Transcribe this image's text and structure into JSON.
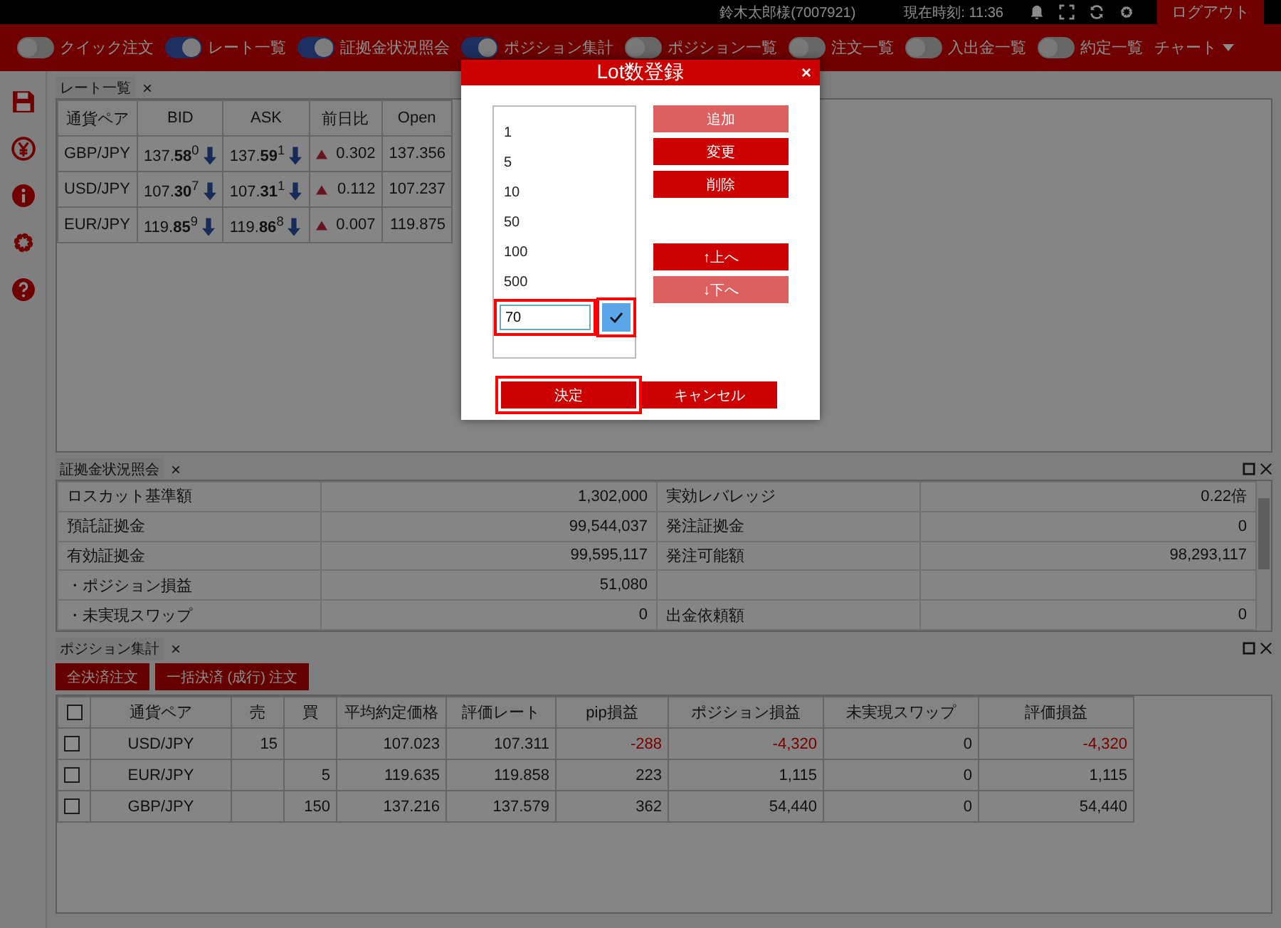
{
  "header": {
    "user": "鈴木太郎様(7007921)",
    "clock": "現在時刻: 11:36",
    "logout": "ログアウト"
  },
  "toolbar": {
    "toggles": [
      {
        "label": "クイック注文",
        "on": false
      },
      {
        "label": "レート一覧",
        "on": true
      },
      {
        "label": "証拠金状況照会",
        "on": true
      },
      {
        "label": "ポジション集計",
        "on": true
      },
      {
        "label": "ポジション一覧",
        "on": false
      },
      {
        "label": "注文一覧",
        "on": false
      },
      {
        "label": "入出金一覧",
        "on": false
      },
      {
        "label": "約定一覧",
        "on": false
      }
    ],
    "chart_menu": "チャート"
  },
  "rate_panel": {
    "tab": "レート一覧",
    "close": "×",
    "columns": [
      "通貨ペア",
      "BID",
      "ASK",
      "前日比",
      "Open"
    ],
    "rows": [
      {
        "pair": "GBP/JPY",
        "bid": "137.**58**$^{0}$",
        "ask": "137.**59**$^{1}$",
        "change": "0.302",
        "open": "137.356"
      },
      {
        "pair": "USD/JPY",
        "bid": "107.**30**$^{7}$",
        "ask": "107.**31**$^{1}$",
        "change": "0.112",
        "open": "107.237"
      },
      {
        "pair": "EUR/JPY",
        "bid": "119.**85**$^{9}$",
        "ask": "119.**86**$^{8}$",
        "change": "0.007",
        "open": "119.875"
      }
    ]
  },
  "margin_panel": {
    "tab": "証拠金状況照会",
    "close": "×",
    "rows": [
      {
        "label1": "ロスカット基準額",
        "value1": "1,302,000",
        "label2": "実効レバレッジ",
        "value2": "0.22倍"
      },
      {
        "label1": "預託証拠金",
        "value1": "99,544,037",
        "label2": "発注証拠金",
        "value2": "0"
      },
      {
        "label1": "有効証拠金",
        "value1": "99,595,117",
        "label2": "発注可能額",
        "value2": "98,293,117"
      },
      {
        "label1": "・ポジション損益",
        "value1": "51,080"
      },
      {
        "label1": "・未実現スワップ",
        "value1": "0",
        "label2": "出金依頼額",
        "value2": "0"
      }
    ]
  },
  "position_panel": {
    "tab": "ポジション集計",
    "close": "×",
    "buttons": [
      "全決済注文",
      "一括決済 (成行) 注文"
    ],
    "select_all_checked": false,
    "columns": [
      "通貨ペア",
      "売",
      "買",
      "平均約定価格",
      "評価レート",
      "pip損益",
      "ポジション損益",
      "未実現スワップ",
      "評価損益"
    ],
    "rows": [
      {
        "checked": false,
        "loss": true,
        "cells": [
          "USD/JPY",
          "15",
          null,
          "107.023",
          "107.311",
          "-288",
          "-4,320",
          "0",
          "-4,320"
        ]
      },
      {
        "checked": false,
        "loss": false,
        "cells": [
          "EUR/JPY",
          null,
          "5",
          "119.635",
          "119.858",
          "223",
          "1,115",
          "0",
          "1,115"
        ]
      },
      {
        "checked": false,
        "loss": false,
        "cells": [
          "GBP/JPY",
          null,
          "150",
          "137.216",
          "137.579",
          "362",
          "54,440",
          "0",
          "54,440"
        ]
      }
    ]
  },
  "dialog": {
    "title": "Lot数登録",
    "close": "×",
    "items": [
      "1",
      "5",
      "10",
      "50",
      "100",
      "500"
    ],
    "edit": {
      "value": "70",
      "highlight": true
    },
    "check_highlight": true,
    "side_buttons": [
      {
        "label": "追加",
        "disabled": true
      },
      {
        "label": "変更",
        "disabled": false
      },
      {
        "label": "削除",
        "disabled": false
      },
      {
        "label": "↑上へ",
        "disabled": false
      },
      {
        "label": "↓下へ",
        "disabled": true
      }
    ],
    "ok": {
      "label": "決定",
      "highlight": true
    },
    "cancel": "キャンセル"
  }
}
